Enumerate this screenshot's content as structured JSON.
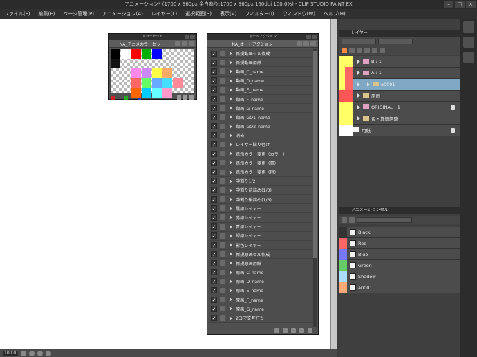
{
  "window": {
    "title": "アニメーション* (1700 x 960px 余白あり:1700 x 960px 160dpi 100.0%) - CLIP STUDIO PAINT EX",
    "controls": [
      "–",
      "□",
      "×"
    ]
  },
  "menu": [
    "ファイル(F)",
    "編集(E)",
    "ページ管理(P)",
    "アニメーション(A)",
    "レイヤー(L)",
    "選択範囲(S)",
    "表示(V)",
    "フィルター(I)",
    "ウィンドウ(W)",
    "ヘルプ(H)"
  ],
  "canvas": {
    "zoom": "100.0"
  },
  "color_set": {
    "title": "カラーセット",
    "set_name": "NA_アニメカラーセット",
    "swatches": [
      {
        "row": 0,
        "col": 0,
        "color": "#000000"
      },
      {
        "row": 0,
        "col": 1,
        "color": "#ffffff"
      },
      {
        "row": 0,
        "col": 2,
        "color": "#ff0000"
      },
      {
        "row": 0,
        "col": 3,
        "color": "#00b000"
      },
      {
        "row": 0,
        "col": 4,
        "color": "#0000ff"
      },
      {
        "row": 1,
        "col": 0,
        "color": "#111111"
      },
      {
        "row": 2,
        "col": 2,
        "color": "#ff88ee"
      },
      {
        "row": 2,
        "col": 3,
        "color": "#cc88ff"
      },
      {
        "row": 2,
        "col": 4,
        "color": "#ffff44"
      },
      {
        "row": 2,
        "col": 5,
        "color": "#ffaa66"
      },
      {
        "row": 3,
        "col": 2,
        "color": "#ff6666"
      },
      {
        "row": 3,
        "col": 3,
        "color": "#66ff66"
      },
      {
        "row": 3,
        "col": 4,
        "color": "#66aaff"
      },
      {
        "row": 3,
        "col": 5,
        "color": "#44ddff"
      },
      {
        "row": 3,
        "col": 6,
        "color": "#ff8899"
      },
      {
        "row": 4,
        "col": 2,
        "color": "#ff6600"
      },
      {
        "row": 4,
        "col": 3,
        "color": "#00ccff"
      },
      {
        "row": 4,
        "col": 4,
        "color": "#66ffff"
      },
      {
        "row": 4,
        "col": 5,
        "color": "#ff99cc"
      }
    ],
    "foot_colors": [
      "#cc2222",
      "#22aa22",
      "#2233cc"
    ]
  },
  "auto_action": {
    "title": "オートアクション",
    "set_name": "NA_オートアクション",
    "items": [
      "新規動画セル作成",
      "新規動画用紙",
      "動画_C_name",
      "動画_D_name",
      "動画_E_name",
      "動画_F_name",
      "動画_G_name",
      "動画_GO1_name",
      "動画_GO2_name",
      "消去",
      "レイヤー貼り付け",
      "表示カラー変更（カラー）",
      "表示カラー変更（青）",
      "表示カラー変更（桃）",
      "中割り1/2",
      "中割り前詰め(1/3)",
      "中割り後詰め(1/3)",
      "黒線レイヤー",
      "赤線レイヤー",
      "青線レイヤー",
      "緑線レイヤー",
      "影色レイヤー",
      "新規原画セル作成",
      "新規原画用紙",
      "原画_C_name",
      "原画_D_name",
      "原画_E_name",
      "原画_F_name",
      "原画_G_name",
      "2コマ交互打ち"
    ]
  },
  "layer_panel": {
    "tab": "レイヤー",
    "layers": [
      {
        "name": "B : 1",
        "eye": "#ffff66",
        "color": "#ffff66",
        "type": "cel",
        "indent": 1
      },
      {
        "name": "A : 1",
        "eye": "#ffff66",
        "color": "#ff6666",
        "type": "cel",
        "indent": 1
      },
      {
        "name": "a0001",
        "eye": "#ffff66",
        "color": "#ff6666",
        "type": "folder",
        "indent": 2,
        "selected": true
      },
      {
        "name": "原画",
        "eye": "#ff5555",
        "color": "#ff5555",
        "type": "folder",
        "indent": 1
      },
      {
        "name": "ORIGINAL : 1",
        "eye": "#ffff66",
        "color": "#ffff66",
        "type": "cel",
        "indent": 1,
        "locked": true
      },
      {
        "name": "色・覚悟調整",
        "eye": "#ffff66",
        "color": "#ffff66",
        "type": "folder",
        "indent": 1
      },
      {
        "name": "用紙",
        "eye": "#ffffff",
        "color": "#ffffff",
        "type": "paper",
        "indent": 0,
        "locked": true
      }
    ]
  },
  "anim_panel": {
    "tab": "アニメーションセル",
    "cels": [
      {
        "name": "Black",
        "color": "#333333"
      },
      {
        "name": "Red",
        "color": "#ff6666"
      },
      {
        "name": "Blue",
        "color": "#7777ff"
      },
      {
        "name": "Green",
        "color": "#66cc66"
      },
      {
        "name": "Shadow",
        "color": "#aaddff"
      },
      {
        "name": "a0001",
        "color": "#ffaa77"
      }
    ]
  }
}
